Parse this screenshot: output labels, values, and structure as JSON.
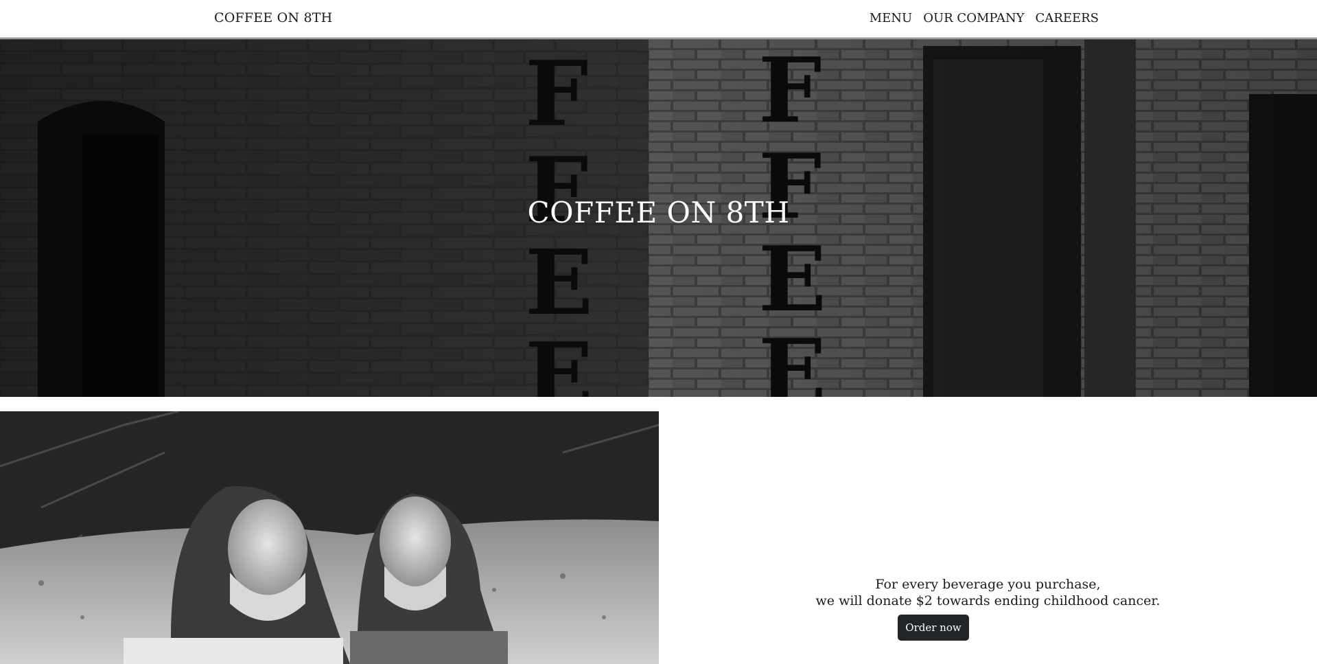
{
  "navbar": {
    "brand": "COFFEE ON 8TH",
    "links": [
      {
        "label": "MENU"
      },
      {
        "label": "OUR COMPANY"
      },
      {
        "label": "CAREERS"
      }
    ]
  },
  "hero": {
    "title": "COFFEE ON 8TH",
    "background_image": "brick-wall-photo"
  },
  "feature": {
    "image": "children-laughing-photo",
    "line1": "For every beverage you purchase,",
    "line2": "we will donate $2 towards ending childhood cancer.",
    "button_label": "Order now"
  },
  "colors": {
    "button_bg": "#212529",
    "text": "#1a1a1a",
    "hero_text": "#ffffff"
  }
}
